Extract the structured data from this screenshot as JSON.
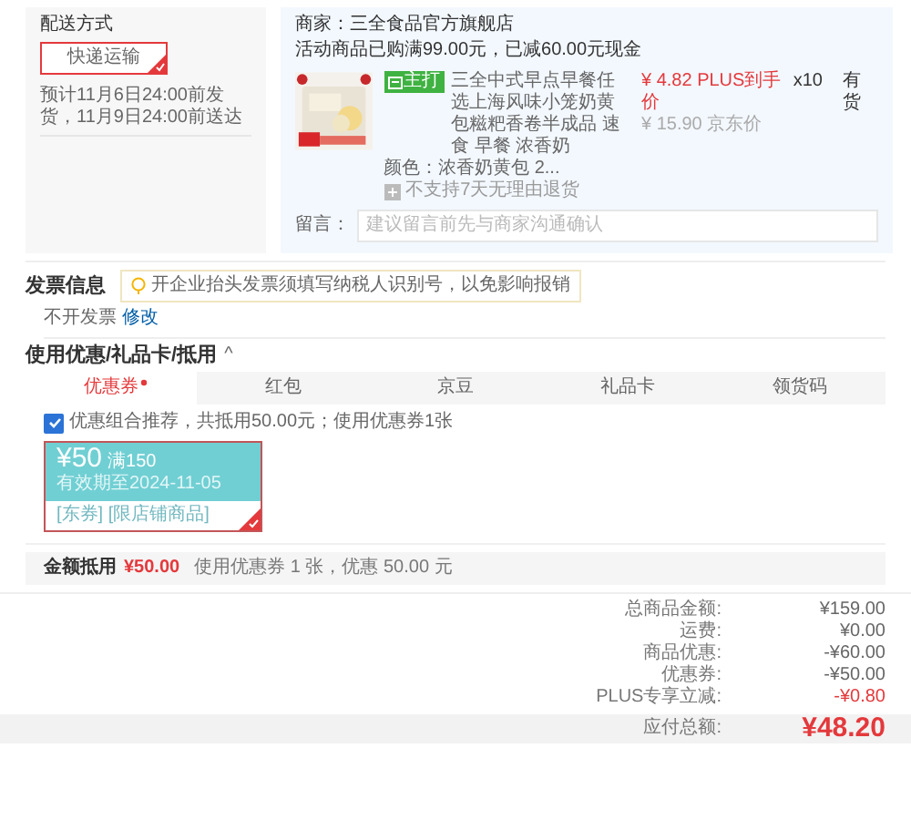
{
  "delivery": {
    "title": "配送方式",
    "option": {
      "label": "快递运输",
      "selected": true
    },
    "estimate": "预计11月6日24:00前发货，11月9日24:00前送达"
  },
  "store": {
    "merchant": "商家：三全食品官方旗舰店",
    "promo": "活动商品已购满99.00元，已减60.00元现金",
    "product": {
      "badge": "主打",
      "title": "三全中式早点早餐任选上海风味小笼奶黄包糍粑香卷半成品 速食 早餐 浓香奶",
      "variant": "颜色：浓香奶黄包 2...",
      "notice": "不支持7天无理由退货",
      "price": "¥ 4.82 PLUS到手价",
      "list_price": "¥ 15.90 京东价",
      "qty": "x10",
      "stock": "有货"
    },
    "note": {
      "label": "留言：",
      "placeholder": "建议留言前先与商家沟通确认"
    }
  },
  "invoice": {
    "title": "发票信息",
    "tip": "开企业抬头发票须填写纳税人识别号，以免影响报销",
    "value": "不开发票",
    "edit": "修改"
  },
  "coupons": {
    "title": "使用优惠/礼品卡/抵用",
    "toggle": "^",
    "tabs": [
      {
        "label": "优惠券",
        "selected": true
      },
      {
        "label": "红包",
        "selected": false
      },
      {
        "label": "京豆",
        "selected": false
      },
      {
        "label": "礼品卡",
        "selected": false
      },
      {
        "label": "领货码",
        "selected": false
      }
    ],
    "combo": {
      "label": "优惠组合推荐，共抵用50.00元；使用优惠券1张",
      "checked": true
    },
    "cards": [
      {
        "amount": "¥50",
        "condition": "满150",
        "expiry": "有效期至2024-11-05",
        "tags": "[东券] [限店铺商品]",
        "selected": true
      }
    ],
    "footer": {
      "label": "金额抵用",
      "amount": "¥50.00",
      "detail": "使用优惠券 1 张，优惠 50.00 元"
    }
  },
  "summary": {
    "rows": [
      {
        "label": "总商品金额:",
        "value": "¥159.00",
        "kind": "plain"
      },
      {
        "label": "运费:",
        "value": "¥0.00",
        "kind": "plain"
      },
      {
        "label": "商品优惠:",
        "value": "-¥60.00",
        "kind": "plain"
      },
      {
        "label": "优惠券:",
        "value": "-¥50.00",
        "kind": "plain"
      },
      {
        "label": "PLUS专享立减:",
        "value": "-¥0.80",
        "kind": "accent"
      }
    ],
    "total": {
      "label": "应付总额:",
      "value": "¥48.20"
    }
  }
}
